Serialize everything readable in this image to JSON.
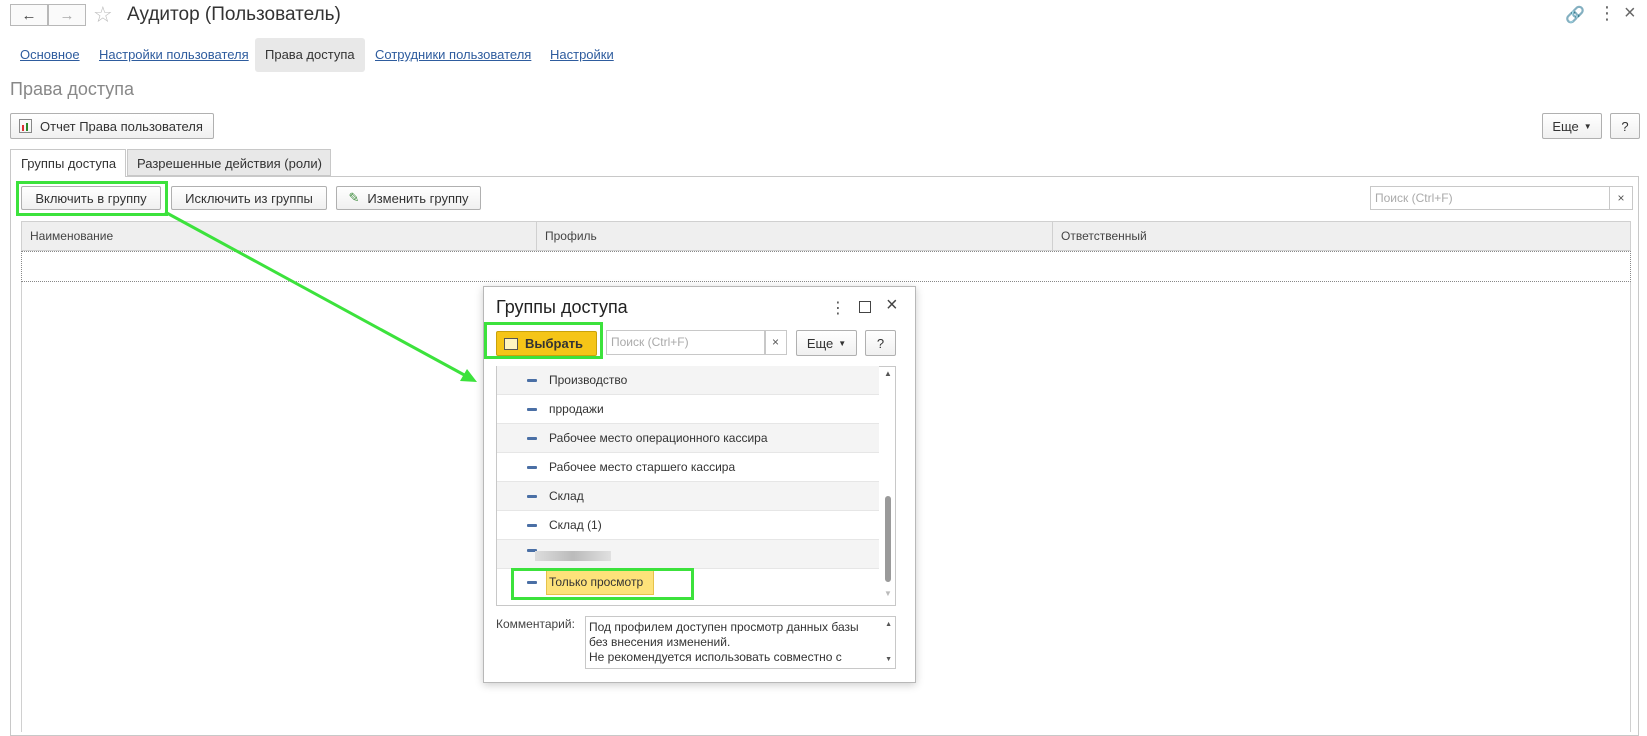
{
  "window": {
    "title": "Аудитор (Пользователь)"
  },
  "nav_tabs": [
    {
      "label": "Основное"
    },
    {
      "label": "Настройки пользователя"
    },
    {
      "label": "Права доступа"
    },
    {
      "label": "Сотрудники пользователя"
    },
    {
      "label": "Настройки"
    }
  ],
  "section_title": "Права доступа",
  "toolbar": {
    "report_label": "Отчет Права пользователя",
    "more_label": "Еще",
    "help_label": "?"
  },
  "sub_tabs": [
    {
      "label": "Группы доступа"
    },
    {
      "label": "Разрешенные действия (роли)"
    }
  ],
  "group_toolbar": {
    "include_label": "Включить в группу",
    "exclude_label": "Исключить из группы",
    "edit_label": "Изменить группу",
    "search_placeholder": "Поиск (Ctrl+F)"
  },
  "table": {
    "columns": [
      "Наименование",
      "Профиль",
      "Ответственный"
    ]
  },
  "dialog": {
    "title": "Группы доступа",
    "select_label": "Выбрать",
    "search_placeholder": "Поиск (Ctrl+F)",
    "more_label": "Еще",
    "help_label": "?",
    "items": [
      {
        "label": "Производство"
      },
      {
        "label": "прродажи"
      },
      {
        "label": "Рабочее место операционного кассира"
      },
      {
        "label": "Рабочее место старшего кассира"
      },
      {
        "label": "Склад"
      },
      {
        "label": "Склад (1)"
      },
      {
        "label": ""
      },
      {
        "label": "Только просмотр"
      }
    ],
    "comment_label": "Комментарий:",
    "comment_text": "Под профилем доступен просмотр данных базы без внесения изменений.\nНе рекомендуется использовать совместно с"
  },
  "colors": {
    "highlight": "#3ce23c",
    "select_button": "#f5c518",
    "link": "#2e5c9e"
  }
}
